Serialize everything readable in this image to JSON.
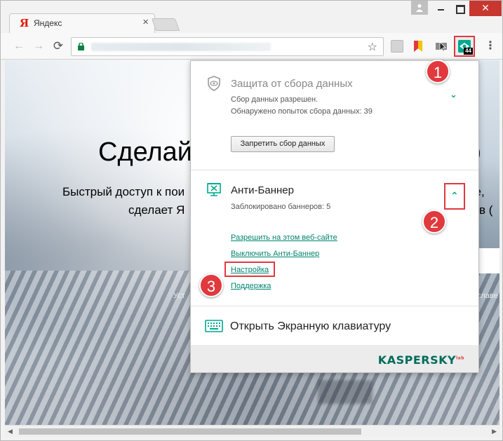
{
  "tab": {
    "title": "Яндекс",
    "favicon_text": "Я",
    "close": "×"
  },
  "window": {
    "close": "✕"
  },
  "toolbar": {
    "back": "←",
    "forward": "→",
    "reload": "⟳",
    "star": "☆",
    "menu": "⋮",
    "kaspersky_badge": "44"
  },
  "page": {
    "hero_title_left": "Сделай",
    "hero_title_right": "тр",
    "hero_sub1_left": "Быстрый доступ к пои",
    "hero_sub1_right": "ие,",
    "hero_sub2_left": "сделает Я",
    "hero_sub2_right": "в (",
    "faint_left": "Уст",
    "faint_right": "славе"
  },
  "popup": {
    "privacy": {
      "title": "Защита от сбора данных",
      "status1": "Сбор данных разрешен.",
      "status2": "Обнаружено попыток сбора данных: 39",
      "button": "Запретить сбор данных",
      "chevron": "⌄"
    },
    "antibanner": {
      "title": "Анти-Баннер",
      "status": "Заблокировано баннеров: 5",
      "chevron": "⌃",
      "links": [
        "Разрешить на этом веб-сайте",
        "Выключить Анти-Баннер",
        "Настройка",
        "Поддержка"
      ]
    },
    "keyboard": {
      "title": "Открыть Экранную клавиатуру"
    },
    "footer": {
      "logo": "KASPERSKY",
      "logo_sup": "lab"
    }
  },
  "callouts": [
    "1",
    "2",
    "3"
  ],
  "colors": {
    "accent": "#00a88e",
    "highlight": "#e0393e",
    "link": "#00856f"
  }
}
